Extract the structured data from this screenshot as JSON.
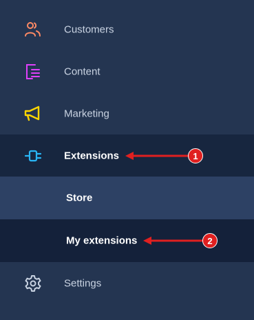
{
  "menu": {
    "customers": {
      "label": "Customers",
      "icon": "users-icon",
      "color": "#ff8a65"
    },
    "content": {
      "label": "Content",
      "icon": "content-icon",
      "color": "#e040fb"
    },
    "marketing": {
      "label": "Marketing",
      "icon": "megaphone-icon",
      "color": "#ffd600"
    },
    "extensions": {
      "label": "Extensions",
      "icon": "plug-icon",
      "color": "#29b6f6"
    },
    "store": {
      "label": "Store"
    },
    "my_extensions": {
      "label": "My extensions"
    },
    "settings": {
      "label": "Settings",
      "icon": "gear-icon",
      "color": "#c9d3e2"
    }
  },
  "annotations": [
    {
      "number": "1",
      "target": "Extensions"
    },
    {
      "number": "2",
      "target": "My extensions"
    }
  ],
  "colors": {
    "sidebar_bg": "#243551",
    "active_bg": "#17263f",
    "store_bg": "#2d4164",
    "my_extensions_bg": "#14213a",
    "annotation_red": "#e02020"
  }
}
